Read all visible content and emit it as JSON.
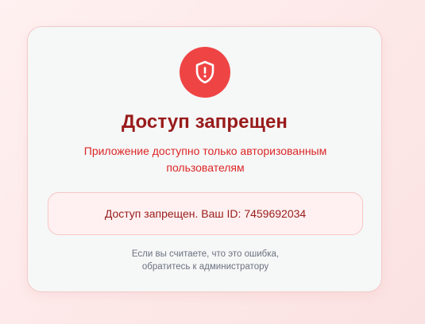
{
  "card": {
    "icon": "shield-alert-icon",
    "title": "Доступ запрещен",
    "subtitle": "Приложение доступно только авторизованным пользователям",
    "id_message": "Доступ запрещен. Ваш ID: 7459692034",
    "footnote_line1": "Если вы считаете, что это ошибка,",
    "footnote_line2": "обратитесь к администратору"
  },
  "colors": {
    "accent": "#ef4444",
    "title": "#991b1b",
    "subtitle": "#dc2626",
    "muted": "#6b7280",
    "page_background": "#fde8e8",
    "card_background": "#f6f7f7"
  }
}
